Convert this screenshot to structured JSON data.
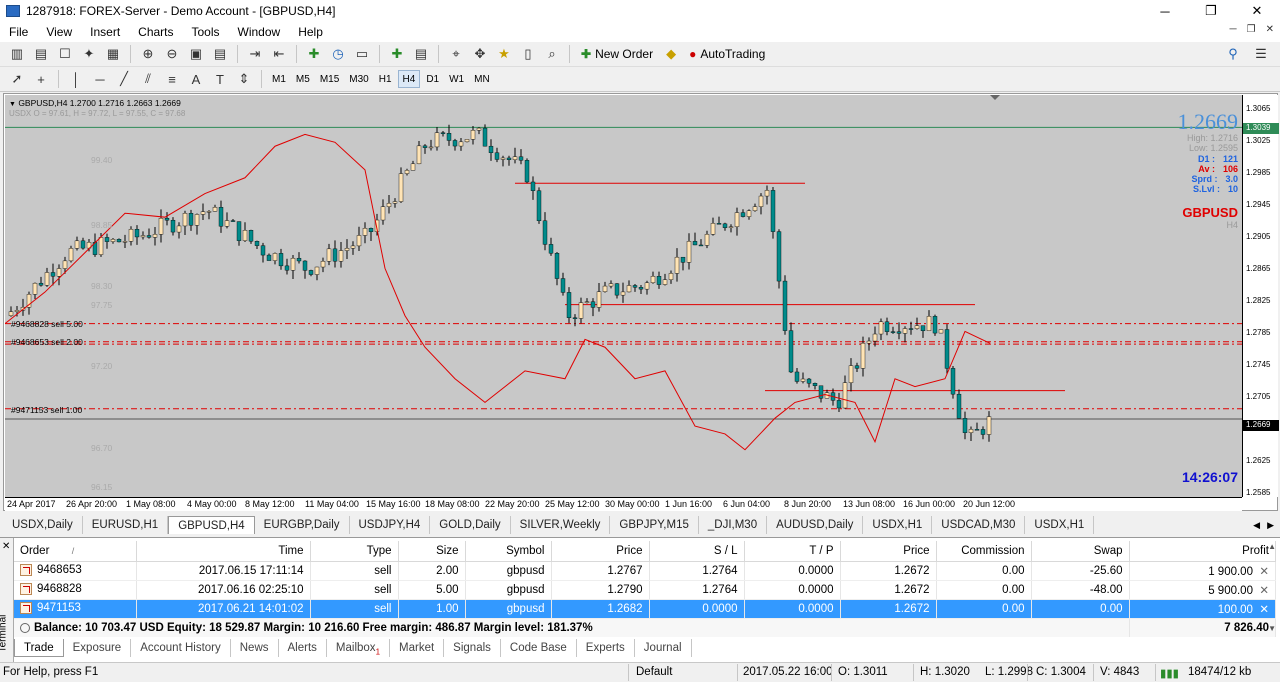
{
  "window": {
    "title": "1287918: FOREX-Server - Demo Account - [GBPUSD,H4]"
  },
  "menu": [
    "File",
    "View",
    "Insert",
    "Charts",
    "Tools",
    "Window",
    "Help"
  ],
  "toolbar": {
    "new_order_label": "New Order",
    "autotrading_label": "AutoTrading"
  },
  "timeframes": [
    "M1",
    "M5",
    "M15",
    "M30",
    "H1",
    "H4",
    "D1",
    "W1",
    "MN"
  ],
  "active_timeframe": "H4",
  "chart": {
    "header": "GBPUSD,H4  1.2700 1.2716 1.2663 1.2669",
    "indicator_header": "USDX O = 97.61, H = 97.72, L = 97.55, C = 97.68",
    "price_ticks": [
      "1.3065",
      "1.3025",
      "1.2985",
      "1.2945",
      "1.2905",
      "1.2865",
      "1.2825",
      "1.2785",
      "1.2745",
      "1.2705",
      "1.2665",
      "1.2625",
      "1.2585"
    ],
    "current_price_tag": "1.2669",
    "green_price_tag": "1.3039",
    "time_ticks": [
      "24 Apr 2017",
      "26 Apr 20:00",
      "1 May 08:00",
      "4 May 00:00",
      "8 May 12:00",
      "11 May 04:00",
      "15 May 16:00",
      "18 May 08:00",
      "22 May 20:00",
      "25 May 12:00",
      "30 May 00:00",
      "1 Jun 16:00",
      "6 Jun 04:00",
      "8 Jun 20:00",
      "13 Jun 08:00",
      "16 Jun 00:00",
      "20 Jun 12:00"
    ],
    "order_labels": [
      "#9468828 sell 5.00",
      "#9468653 sell 2.00",
      "#9471153 sell 1.00"
    ],
    "indicator_ticks": [
      "99.40",
      "98.85",
      "98.30",
      "97.75",
      "97.20",
      "96.70",
      "96.15"
    ],
    "info": {
      "big_price": "1.2669",
      "high": "High: 1.2716",
      "low": "Low: 1.2595",
      "d1_label": "D1 :",
      "d1": "121",
      "av_label": "Av :",
      "av": "106",
      "sprd_label": "Sprd :",
      "sprd": "3.0",
      "slvl_label": "S.Lvl :",
      "slvl": "10",
      "symbol": "GBPUSD",
      "period": "H4",
      "clock": "14:26:07"
    }
  },
  "chart_tabs": [
    "USDX,Daily",
    "EURUSD,H1",
    "GBPUSD,H4",
    "EURGBP,Daily",
    "USDJPY,H4",
    "GOLD,Daily",
    "SILVER,Weekly",
    "GBPJPY,M15",
    "_DJI,M30",
    "AUDUSD,Daily",
    "USDX,H1",
    "USDCAD,M30",
    "USDX,H1"
  ],
  "active_chart_tab": 2,
  "terminal": {
    "side_label": "Terminal",
    "columns": [
      "Order",
      "Time",
      "Type",
      "Size",
      "Symbol",
      "Price",
      "S / L",
      "T / P",
      "Price",
      "Commission",
      "Swap",
      "Profit"
    ],
    "sort_marker": "/",
    "rows": [
      {
        "order": "9468653",
        "time": "2017.06.15 17:11:14",
        "type": "sell",
        "size": "2.00",
        "symbol": "gbpusd",
        "price": "1.2767",
        "sl": "1.2764",
        "tp": "0.0000",
        "cur": "1.2672",
        "commission": "0.00",
        "swap": "-25.60",
        "profit": "1 900.00"
      },
      {
        "order": "9468828",
        "time": "2017.06.16 02:25:10",
        "type": "sell",
        "size": "5.00",
        "symbol": "gbpusd",
        "price": "1.2790",
        "sl": "1.2764",
        "tp": "0.0000",
        "cur": "1.2672",
        "commission": "0.00",
        "swap": "-48.00",
        "profit": "5 900.00"
      },
      {
        "order": "9471153",
        "time": "2017.06.21 14:01:02",
        "type": "sell",
        "size": "1.00",
        "symbol": "gbpusd",
        "price": "1.2682",
        "sl": "0.0000",
        "tp": "0.0000",
        "cur": "1.2672",
        "commission": "0.00",
        "swap": "0.00",
        "profit": "100.00"
      }
    ],
    "balance_line": "Balance: 10 703.47 USD  Equity: 18 529.87  Margin: 10 216.60  Free margin: 486.87  Margin level: 181.37%",
    "total_profit": "7 826.40",
    "tabs": [
      "Trade",
      "Exposure",
      "Account History",
      "News",
      "Alerts",
      "Mailbox",
      "Market",
      "Signals",
      "Code Base",
      "Experts",
      "Journal"
    ],
    "mailbox_badge": "1"
  },
  "status": {
    "help": "For Help, press F1",
    "profile": "Default",
    "datetime": "2017.05.22 16:00",
    "open": "O: 1.3011",
    "high": "H: 1.3020",
    "low": "L: 1.2998",
    "close": "C: 1.3004",
    "volume": "V: 4843",
    "traffic": "18474/12 kb"
  },
  "colors": {
    "chart_bg": "#c8c8c8",
    "bull_candle": "#ffe4b5",
    "bear_candle": "#008b8b",
    "order_line": "#ff0000",
    "selected_row": "#3399ff"
  }
}
